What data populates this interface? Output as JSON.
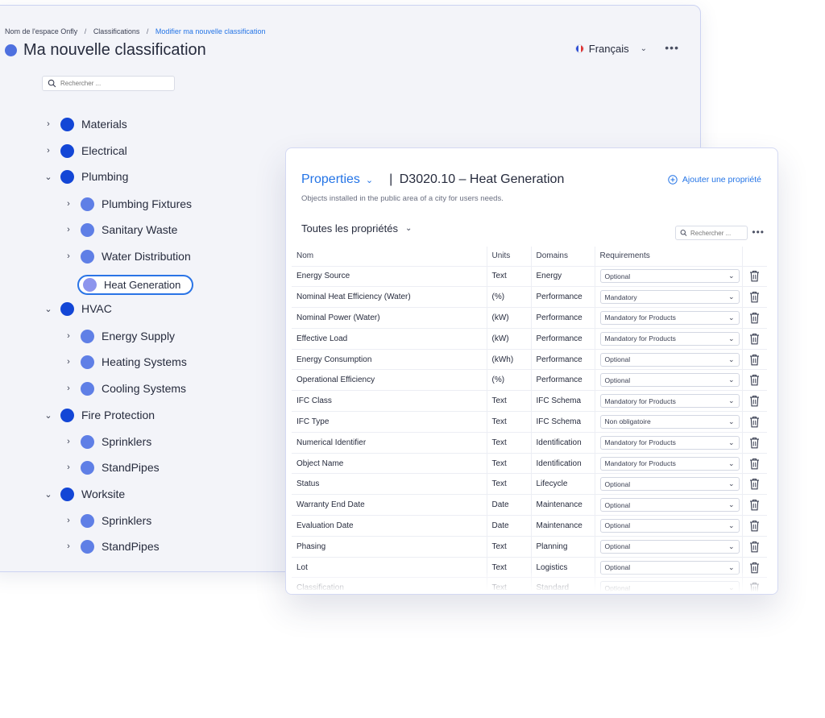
{
  "breadcrumb": {
    "workspace": "Nom de l'espace Onfly",
    "separator": "/",
    "section": "Classifications",
    "current": "Modifier ma nouvelle classification"
  },
  "page": {
    "title": "Ma nouvelle classification",
    "language": "Français",
    "more": "•••"
  },
  "tree_search": {
    "placeholder": "Rechercher ..."
  },
  "tree": [
    {
      "label": "Materials",
      "level": 1,
      "expanded": false
    },
    {
      "label": "Electrical",
      "level": 1,
      "expanded": false
    },
    {
      "label": "Plumbing",
      "level": 1,
      "expanded": true
    },
    {
      "label": "Plumbing Fixtures",
      "level": 2,
      "expanded": false
    },
    {
      "label": "Sanitary Waste",
      "level": 2,
      "expanded": false
    },
    {
      "label": "Water Distribution",
      "level": 2,
      "expanded": false
    },
    {
      "label": "Heat Generation",
      "level": 3,
      "selected": true
    },
    {
      "label": "HVAC",
      "level": 1,
      "expanded": true
    },
    {
      "label": "Energy Supply",
      "level": 2,
      "expanded": false
    },
    {
      "label": "Heating Systems",
      "level": 2,
      "expanded": false
    },
    {
      "label": "Cooling Systems",
      "level": 2,
      "expanded": false
    },
    {
      "label": "Fire Protection",
      "level": 1,
      "expanded": true
    },
    {
      "label": "Sprinklers",
      "level": 2,
      "expanded": false
    },
    {
      "label": "StandPipes",
      "level": 2,
      "expanded": false
    },
    {
      "label": "Worksite",
      "level": 1,
      "expanded": true
    },
    {
      "label": "Sprinklers",
      "level": 2,
      "expanded": false
    },
    {
      "label": "StandPipes",
      "level": 2,
      "expanded": false
    }
  ],
  "card": {
    "properties_label": "Properties",
    "title_separator": "|",
    "title": "D3020.10 – Heat Generation",
    "description": "Objects installed in the public area of a city for users needs.",
    "add_property": "Ajouter une propriété",
    "filter": "Toutes les propriétés",
    "search_placeholder": "Rechercher ...",
    "more": "•••"
  },
  "table": {
    "headers": {
      "name": "Nom",
      "units": "Units",
      "domains": "Domains",
      "requirements": "Requirements"
    },
    "rows": [
      {
        "name": "Energy Source",
        "units": "Text",
        "domain": "Energy",
        "requirement": "Optional"
      },
      {
        "name": "Nominal Heat Efficiency (Water)",
        "units": "(%)",
        "domain": "Performance",
        "requirement": "Mandatory"
      },
      {
        "name": "Nominal Power (Water)",
        "units": "(kW)",
        "domain": "Performance",
        "requirement": "Mandatory for Products"
      },
      {
        "name": "Effective Load",
        "units": "(kW)",
        "domain": "Performance",
        "requirement": "Mandatory for Products"
      },
      {
        "name": "Energy Consumption",
        "units": "(kWh)",
        "domain": "Performance",
        "requirement": "Optional"
      },
      {
        "name": "Operational Efficiency",
        "units": "(%)",
        "domain": "Performance",
        "requirement": "Optional"
      },
      {
        "name": "IFC Class",
        "units": "Text",
        "domain": "IFC Schema",
        "requirement": "Mandatory for Products"
      },
      {
        "name": "IFC Type",
        "units": "Text",
        "domain": "IFC Schema",
        "requirement": "Non obligatoire"
      },
      {
        "name": "Numerical Identifier",
        "units": "Text",
        "domain": "Identification",
        "requirement": "Mandatory for Products"
      },
      {
        "name": "Object Name",
        "units": "Text",
        "domain": "Identification",
        "requirement": "Mandatory for Products"
      },
      {
        "name": "Status",
        "units": "Text",
        "domain": "Lifecycle",
        "requirement": "Optional"
      },
      {
        "name": "Warranty End Date",
        "units": "Date",
        "domain": "Maintenance",
        "requirement": "Optional"
      },
      {
        "name": "Evaluation Date",
        "units": "Date",
        "domain": "Maintenance",
        "requirement": "Optional"
      },
      {
        "name": "Phasing",
        "units": "Text",
        "domain": "Planning",
        "requirement": "Optional"
      },
      {
        "name": "Lot",
        "units": "Text",
        "domain": "Logistics",
        "requirement": "Optional"
      },
      {
        "name": "Classification",
        "units": "Text",
        "domain": "Standard",
        "requirement": "Optional"
      }
    ]
  },
  "icons": {
    "search": "search-icon",
    "plus": "plus-circle-icon",
    "trash": "trash-icon",
    "chevron_down": "chevron-down-icon",
    "chevron_right": "chevron-right-icon"
  },
  "colors": {
    "accent": "#2474e6",
    "node_level1": "#1346d6",
    "node_level2": "#5f7fe6",
    "node_selected": "#8d95ed"
  }
}
